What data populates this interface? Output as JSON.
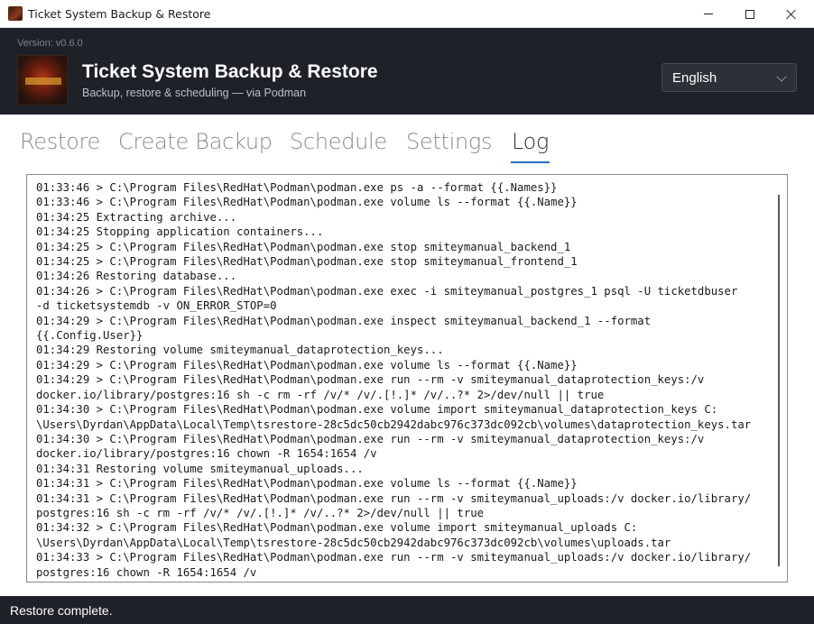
{
  "window": {
    "title": "Ticket System Backup & Restore"
  },
  "header": {
    "version": "Version: v0.6.0",
    "title": "Ticket System Backup & Restore",
    "subtitle": "Backup, restore & scheduling — via Podman",
    "language": {
      "selected": "English"
    }
  },
  "tabs": [
    {
      "label": "Restore"
    },
    {
      "label": "Create Backup"
    },
    {
      "label": "Schedule"
    },
    {
      "label": "Settings"
    },
    {
      "label": "Log",
      "active": true
    }
  ],
  "log": {
    "lines": [
      "01:33:46 > C:\\Program Files\\RedHat\\Podman\\podman.exe ps -a --format {{.Names}}",
      "01:33:46 > C:\\Program Files\\RedHat\\Podman\\podman.exe volume ls --format {{.Name}}",
      "01:34:25 Extracting archive...",
      "01:34:25 Stopping application containers...",
      "01:34:25 > C:\\Program Files\\RedHat\\Podman\\podman.exe stop smiteymanual_backend_1",
      "01:34:25 > C:\\Program Files\\RedHat\\Podman\\podman.exe stop smiteymanual_frontend_1",
      "01:34:26 Restoring database...",
      "01:34:26 > C:\\Program Files\\RedHat\\Podman\\podman.exe exec -i smiteymanual_postgres_1 psql -U ticketdbuser",
      "-d ticketsystemdb -v ON_ERROR_STOP=0",
      "01:34:29 > C:\\Program Files\\RedHat\\Podman\\podman.exe inspect smiteymanual_backend_1 --format",
      "{{.Config.User}}",
      "01:34:29 Restoring volume smiteymanual_dataprotection_keys...",
      "01:34:29 > C:\\Program Files\\RedHat\\Podman\\podman.exe volume ls --format {{.Name}}",
      "01:34:29 > C:\\Program Files\\RedHat\\Podman\\podman.exe run --rm -v smiteymanual_dataprotection_keys:/v",
      "docker.io/library/postgres:16 sh -c rm -rf /v/* /v/.[!.]* /v/..?* 2>/dev/null || true",
      "01:34:30 > C:\\Program Files\\RedHat\\Podman\\podman.exe volume import smiteymanual_dataprotection_keys C:",
      "\\Users\\Dyrdan\\AppData\\Local\\Temp\\tsrestore-28c5dc50cb2942dabc976c373dc092cb\\volumes\\dataprotection_keys.tar",
      "01:34:30 > C:\\Program Files\\RedHat\\Podman\\podman.exe run --rm -v smiteymanual_dataprotection_keys:/v",
      "docker.io/library/postgres:16 chown -R 1654:1654 /v",
      "01:34:31 Restoring volume smiteymanual_uploads...",
      "01:34:31 > C:\\Program Files\\RedHat\\Podman\\podman.exe volume ls --format {{.Name}}",
      "01:34:31 > C:\\Program Files\\RedHat\\Podman\\podman.exe run --rm -v smiteymanual_uploads:/v docker.io/library/",
      "postgres:16 sh -c rm -rf /v/* /v/.[!.]* /v/..?* 2>/dev/null || true",
      "01:34:32 > C:\\Program Files\\RedHat\\Podman\\podman.exe volume import smiteymanual_uploads C:",
      "\\Users\\Dyrdan\\AppData\\Local\\Temp\\tsrestore-28c5dc50cb2942dabc976c373dc092cb\\volumes\\uploads.tar",
      "01:34:33 > C:\\Program Files\\RedHat\\Podman\\podman.exe run --rm -v smiteymanual_uploads:/v docker.io/library/",
      "postgres:16 chown -R 1654:1654 /v"
    ]
  },
  "status": {
    "text": "Restore complete."
  },
  "colors": {
    "header_bg": "#1e2228",
    "accent": "#2a6eb8"
  }
}
